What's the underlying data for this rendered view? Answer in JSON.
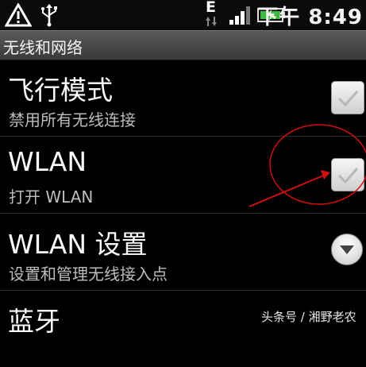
{
  "status_bar": {
    "network_type": "E",
    "time": "下午 8:49",
    "icons": [
      "warning-icon",
      "usb-icon",
      "data-arrows-icon",
      "signal-icon",
      "battery-charging-icon"
    ]
  },
  "section": {
    "title": "无线和网络"
  },
  "rows": [
    {
      "title": "飞行模式",
      "summary": "禁用所有无线连接",
      "control": "checkbox",
      "checked": false
    },
    {
      "title": "WLAN",
      "summary": "打开 WLAN",
      "control": "checkbox",
      "checked": false
    },
    {
      "title": "WLAN 设置",
      "summary": "设置和管理无线接入点",
      "control": "dropdown"
    },
    {
      "title": "蓝牙",
      "summary": "",
      "control": "none"
    }
  ],
  "annotation": {
    "color": "#d01010"
  },
  "watermark": "头条号 / 湘野老农"
}
